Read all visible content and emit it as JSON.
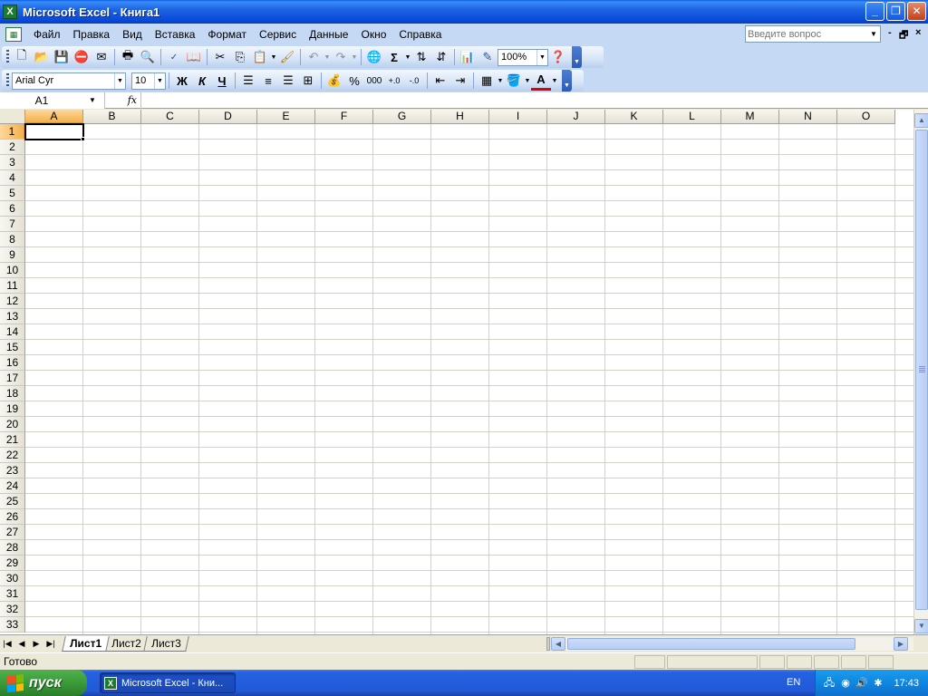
{
  "window": {
    "app_icon": "excel-icon",
    "title": "Microsoft Excel - Книга1",
    "buttons": {
      "minimize": "_",
      "maximize": "❐",
      "close": "✕"
    }
  },
  "menu": {
    "items": [
      "Файл",
      "Правка",
      "Вид",
      "Вставка",
      "Формат",
      "Сервис",
      "Данные",
      "Окно",
      "Справка"
    ],
    "help_placeholder": "Введите вопрос",
    "doc_controls": {
      "minimize": "-",
      "restore": "🗗",
      "close": "×"
    }
  },
  "standard_toolbar": {
    "zoom": "100%",
    "icons": [
      "new-icon",
      "open-icon",
      "save-icon",
      "permission-icon",
      "email-icon",
      "print-icon",
      "print-preview-icon",
      "spelling-icon",
      "research-icon",
      "cut-icon",
      "copy-icon",
      "paste-icon",
      "format-painter-icon",
      "undo-icon",
      "redo-icon",
      "hyperlink-icon",
      "autosum-icon",
      "sort-asc-icon",
      "sort-desc-icon",
      "chart-wizard-icon",
      "drawing-icon",
      "help-icon"
    ]
  },
  "formatting_toolbar": {
    "font": "Arial Cyr",
    "size": "10",
    "bold": "Ж",
    "italic": "К",
    "underline": "Ч",
    "percent": "%",
    "thousands": "000",
    "font_color_glyph": "A"
  },
  "formula_bar": {
    "name_box": "A1",
    "fx": "fx",
    "formula": ""
  },
  "grid": {
    "columns": [
      "A",
      "B",
      "C",
      "D",
      "E",
      "F",
      "G",
      "H",
      "I",
      "J",
      "K",
      "L",
      "M",
      "N",
      "O"
    ],
    "rows": [
      "1",
      "2",
      "3",
      "4",
      "5",
      "6",
      "7",
      "8",
      "9",
      "10",
      "11",
      "12",
      "13",
      "14",
      "15",
      "16",
      "17",
      "18",
      "19",
      "20",
      "21",
      "22",
      "23",
      "24",
      "25",
      "26",
      "27",
      "28",
      "29",
      "30",
      "31",
      "32",
      "33"
    ],
    "active_cell": "A1"
  },
  "sheet_tabs": [
    "Лист1",
    "Лист2",
    "Лист3"
  ],
  "active_sheet": "Лист1",
  "status": {
    "text": "Готово"
  },
  "taskbar": {
    "start_label": "пуск",
    "task_label": "Microsoft Excel - Кни...",
    "language": "EN",
    "clock": "17:43"
  },
  "colors": {
    "titlebar": "#0848d8",
    "active_header": "#f4b04a",
    "start_button": "#3c9a3a"
  }
}
